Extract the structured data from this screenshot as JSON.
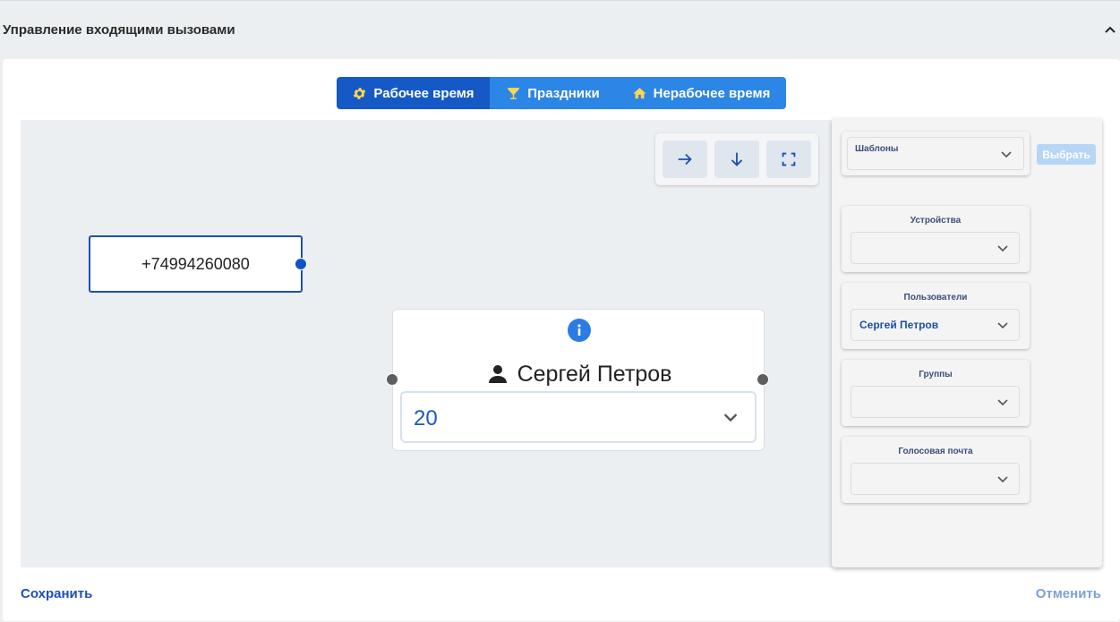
{
  "section": {
    "title": "Управление входящими вызовами"
  },
  "tabs": [
    {
      "label": "Рабочее время",
      "icon": "gear-icon",
      "active": true
    },
    {
      "label": "Праздники",
      "icon": "cocktail-icon",
      "active": false
    },
    {
      "label": "Нерабочее время",
      "icon": "home-icon",
      "active": false
    }
  ],
  "canvas_controls": [
    "arrow-right-icon",
    "arrow-down-icon",
    "fullscreen-icon"
  ],
  "phone_node": {
    "number": "+74994260080"
  },
  "user_node": {
    "name": "Сергей Петров",
    "selected_value": "20"
  },
  "sidebar": {
    "templates": {
      "label": "Шаблоны",
      "value": ""
    },
    "choose_label": "Выбрать",
    "devices": {
      "label": "Устройства",
      "value": ""
    },
    "users": {
      "label": "Пользователи",
      "value": "Сергей Петров"
    },
    "groups": {
      "label": "Группы",
      "value": ""
    },
    "voicemail": {
      "label": "Голосовая почта",
      "value": ""
    }
  },
  "footer": {
    "save_label": "Сохранить",
    "cancel_label": "Отменить"
  },
  "colors": {
    "tab_active": "#1559c6",
    "tab_inactive": "#2b86e5",
    "tab_icon": "#ffd54f",
    "accent": "#1c4fb5",
    "handle_blue": "#1450c8",
    "handle_grey": "#5e5e5e"
  }
}
